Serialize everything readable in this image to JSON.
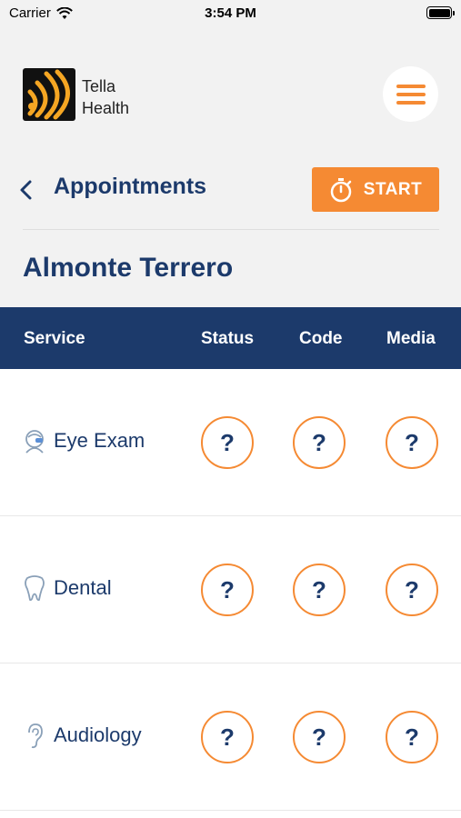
{
  "status_bar": {
    "carrier": "Carrier",
    "time": "3:54 PM"
  },
  "brand": {
    "line1": "Tella",
    "line2": "Health"
  },
  "nav": {
    "title": "Appointments",
    "start_label": "START"
  },
  "patient_name": "Almonte Terrero",
  "table": {
    "headers": {
      "service": "Service",
      "status": "Status",
      "code": "Code",
      "media": "Media"
    },
    "rows": [
      {
        "service": "Eye Exam",
        "icon": "eye-exam-icon",
        "status": "?",
        "code": "?",
        "media": "?"
      },
      {
        "service": "Dental",
        "icon": "tooth-icon",
        "status": "?",
        "code": "?",
        "media": "?"
      },
      {
        "service": "Audiology",
        "icon": "ear-icon",
        "status": "?",
        "code": "?",
        "media": "?"
      }
    ]
  },
  "colors": {
    "accent": "#f58a33",
    "navy": "#1c3a6b",
    "background": "#f2f2f2"
  }
}
